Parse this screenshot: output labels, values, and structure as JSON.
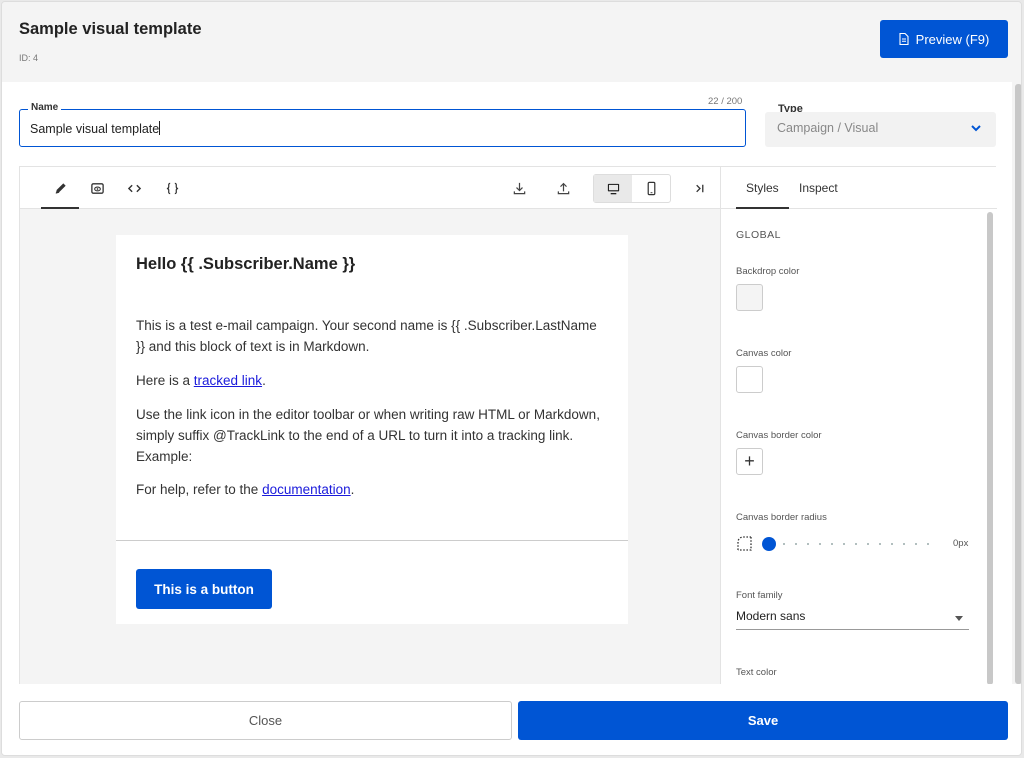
{
  "header": {
    "title": "Sample visual template",
    "id_text": "ID: 4",
    "preview_label": "Preview (F9)"
  },
  "form": {
    "name_label": "Name",
    "name_value": "Sample visual template",
    "char_count": "22 / 200",
    "type_label": "Type",
    "type_value": "Campaign / Visual"
  },
  "toolbar": {
    "icons": [
      "pencil-icon",
      "preview-eye-icon",
      "code-icon",
      "braces-icon",
      "download-icon",
      "upload-icon",
      "desktop-icon",
      "mobile-icon",
      "collapse-panel-icon"
    ]
  },
  "email": {
    "heading": "Hello {{ .Subscriber.Name }}",
    "para1": "This is a test e-mail campaign. Your second name is {{ .Subscriber.LastName }} and this block of text is in Markdown.",
    "para2_prefix": "Here is a ",
    "para2_link": "tracked link",
    "para2_suffix": ".",
    "para3": "Use the link icon in the editor toolbar or when writing raw HTML or Markdown, simply suffix @TrackLink to the end of a URL to turn it into a tracking link. Example:",
    "para4_prefix": "For help, refer to the ",
    "para4_link": "documentation",
    "para4_suffix": ".",
    "button_label": "This is a button"
  },
  "side_panel": {
    "tabs": [
      "Styles",
      "Inspect"
    ],
    "section": "GLOBAL",
    "backdrop_label": "Backdrop color",
    "backdrop_color": "#f4f4f4",
    "canvas_label": "Canvas color",
    "canvas_color": "#ffffff",
    "border_color_label": "Canvas border color",
    "border_color_add": "+",
    "radius_label": "Canvas border radius",
    "radius_value": "0px",
    "font_label": "Font family",
    "font_value": "Modern sans",
    "text_color_label": "Text color"
  },
  "footer": {
    "close_label": "Close",
    "save_label": "Save"
  },
  "colors": {
    "accent": "#0055d4",
    "link": "#1a1adb"
  }
}
